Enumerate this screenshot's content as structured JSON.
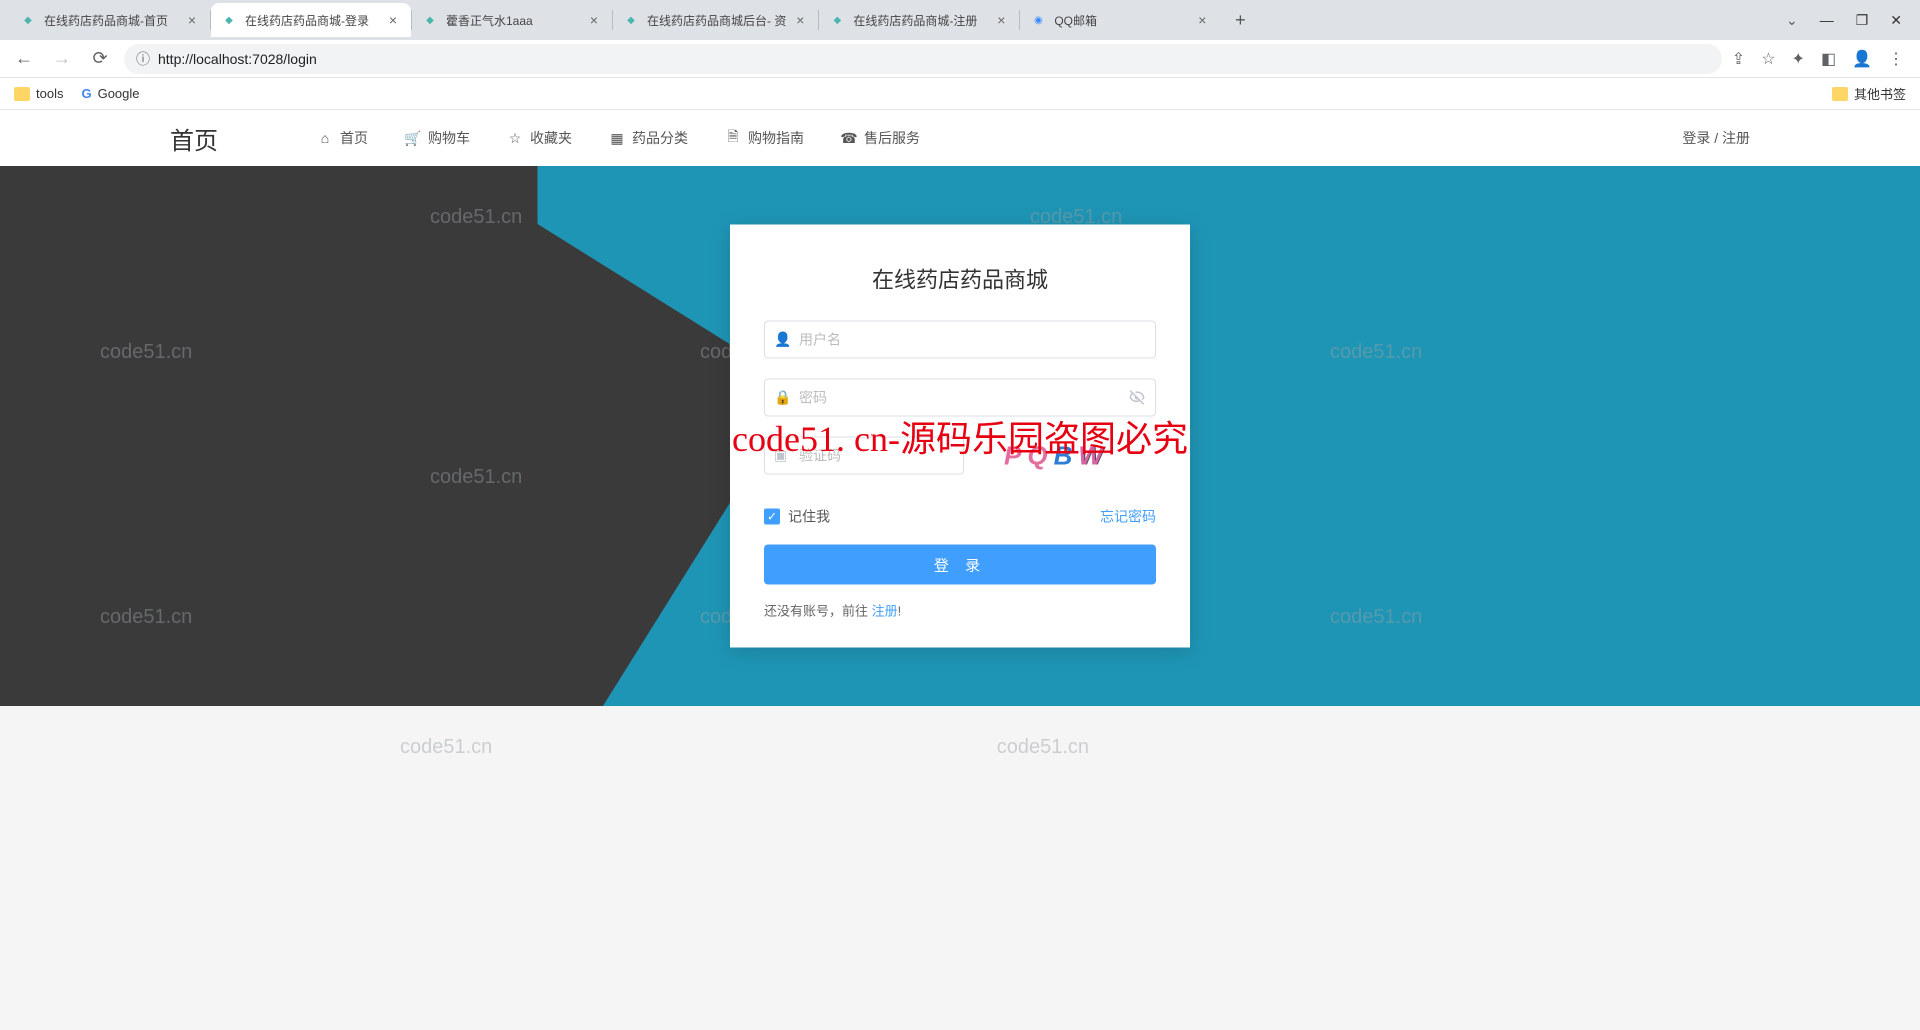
{
  "browser": {
    "tabs": [
      {
        "title": "在线药店药品商城-首页",
        "favicon_color": "#4db6ac"
      },
      {
        "title": "在线药店药品商城-登录",
        "favicon_color": "#4db6ac",
        "active": true
      },
      {
        "title": "藿香正气水1aaa",
        "favicon_color": "#4db6ac"
      },
      {
        "title": "在线药店药品商城后台- 资",
        "favicon_color": "#4db6ac"
      },
      {
        "title": "在线药店药品商城-注册",
        "favicon_color": "#4db6ac"
      },
      {
        "title": "QQ邮箱",
        "favicon_color": "#3b8bff"
      }
    ],
    "url": "http://localhost:7028/login",
    "bookmarks": {
      "tools": "tools",
      "google": "Google",
      "other": "其他书签"
    }
  },
  "nav": {
    "title": "首页",
    "items": [
      {
        "label": "首页",
        "icon": "home"
      },
      {
        "label": "购物车",
        "icon": "cart"
      },
      {
        "label": "收藏夹",
        "icon": "star"
      },
      {
        "label": "药品分类",
        "icon": "grid"
      },
      {
        "label": "购物指南",
        "icon": "doc"
      },
      {
        "label": "售后服务",
        "icon": "service"
      }
    ],
    "right": "登录 / 注册"
  },
  "login": {
    "title": "在线药店药品商城",
    "username_placeholder": "用户名",
    "password_placeholder": "密码",
    "captcha_placeholder": "验证码",
    "captcha_text": "PQBW",
    "remember": "记住我",
    "forgot": "忘记密码",
    "submit": "登 录",
    "no_account": "还没有账号，前往 ",
    "register": "注册",
    "exclaim": "!"
  },
  "watermarks": {
    "main": "code51. cn-源码乐园盗图必究",
    "light": "code51.cn"
  }
}
